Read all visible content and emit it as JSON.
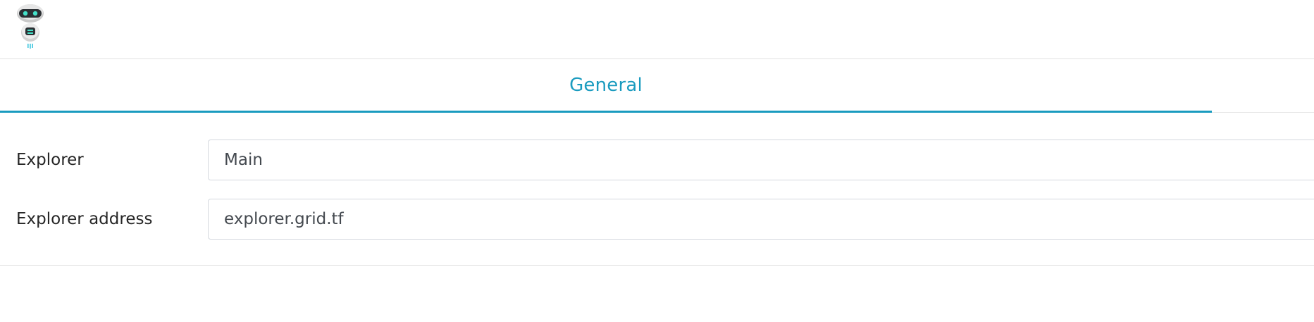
{
  "header": {
    "logo_icon": "robot-logo-icon"
  },
  "tabs": [
    {
      "label": "General",
      "active": true
    }
  ],
  "form": {
    "explorer": {
      "label": "Explorer",
      "value": "Main"
    },
    "explorer_address": {
      "label": "Explorer address",
      "value": "explorer.grid.tf"
    }
  },
  "colors": {
    "accent": "#1a9bbf",
    "border": "#d4d8de",
    "divider": "#e3e3e3"
  }
}
